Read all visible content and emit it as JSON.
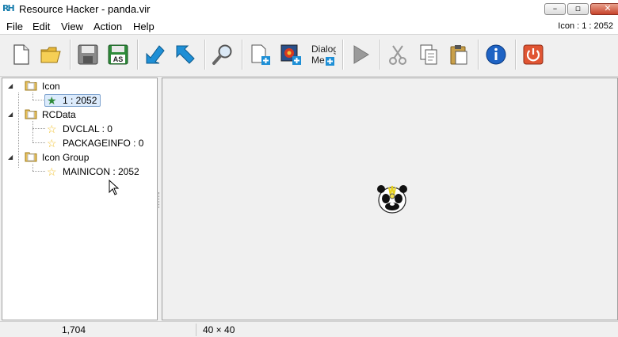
{
  "window": {
    "title": "Resource Hacker - panda.vir",
    "logo_text": "RH",
    "minimize_glyph": "–",
    "maximize_glyph": "▫",
    "close_glyph": "✕"
  },
  "menu": {
    "items": [
      "File",
      "Edit",
      "View",
      "Action",
      "Help"
    ],
    "current_resource": "Icon : 1 : 2052"
  },
  "toolbar": {
    "icons": [
      "new-file-icon",
      "open-folder-icon",
      "save-icon",
      "save-as-icon",
      "compile-icon",
      "go-to-icon",
      "find-icon",
      "add-resource-icon",
      "add-image-icon",
      "dialog-menu-icon",
      "play-icon",
      "cut-icon",
      "copy-icon",
      "paste-icon",
      "info-icon",
      "exit-icon"
    ],
    "save_as_label": "AS",
    "dialog_label_1": "Dialog",
    "dialog_label_2": "Me"
  },
  "tree": {
    "nodes": [
      {
        "label": "Icon",
        "type": "folder",
        "expanded": true
      },
      {
        "label": "1 : 2052",
        "type": "resource",
        "selected": true
      },
      {
        "label": "RCData",
        "type": "folder",
        "expanded": true
      },
      {
        "label": "DVCLAL : 0",
        "type": "resource"
      },
      {
        "label": "PACKAGEINFO : 0",
        "type": "resource"
      },
      {
        "label": "Icon Group",
        "type": "folder",
        "expanded": true
      },
      {
        "label": "MAINICON : 2052",
        "type": "resource"
      }
    ]
  },
  "colors": {
    "accent_blue": "#1e8fd6",
    "selection_bg": "#dcebfc",
    "selection_border": "#7da2ce"
  },
  "statusbar": {
    "size_value": "1,704",
    "dimensions": "40 × 40"
  }
}
